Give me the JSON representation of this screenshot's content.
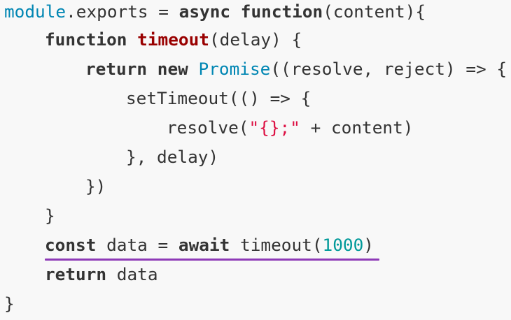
{
  "editor": {
    "accent_color": "#8e3ab7",
    "colors": {
      "keyword": "#333333",
      "function_name": "#990000",
      "builtin": "#0086b3",
      "string": "#dd1144",
      "number": "#009999",
      "text": "#333333",
      "background": "#f8f8f8"
    },
    "line1": {
      "module": "module",
      "exports": ".exports = ",
      "async": "async",
      "function": " function",
      "rest": "(content){"
    },
    "line2": {
      "function": "function",
      "name": " timeout",
      "rest": "(delay) {"
    },
    "line3": {
      "return": "return",
      "new": " new",
      "promise": " Promise",
      "rest": "((resolve, reject) => {"
    },
    "line4": {
      "text": "setTimeout(() => {"
    },
    "line5": {
      "pre": "resolve(",
      "string": "\"{};\"",
      "post": " + content)"
    },
    "line6": {
      "text": "}, delay)"
    },
    "line7": {
      "text": "})"
    },
    "line8": {
      "text": "}"
    },
    "line9": {
      "const": "const",
      "mid": " data = ",
      "await": "await",
      "call": " timeout(",
      "number": "1000",
      "close": ")"
    },
    "line10": {
      "return": "return",
      "rest": " data"
    },
    "line11": {
      "text": "}"
    }
  }
}
